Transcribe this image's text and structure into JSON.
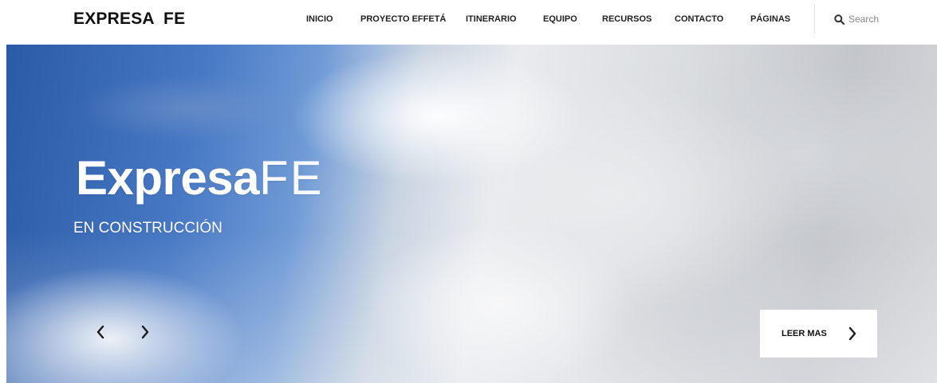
{
  "header": {
    "logo": "EXPRESA  FE",
    "nav": [
      {
        "label": "INICIO",
        "name": "nav-inicio"
      },
      {
        "label": "PROYECTO EFFETÁ",
        "name": "nav-proyecto-effeta"
      },
      {
        "label": "ITINERARIO",
        "name": "nav-itinerario"
      },
      {
        "label": "EQUIPO",
        "name": "nav-equipo"
      },
      {
        "label": "RECURSOS",
        "name": "nav-recursos"
      },
      {
        "label": "CONTACTO",
        "name": "nav-contacto"
      },
      {
        "label": "PÁGINAS",
        "name": "nav-paginas"
      }
    ],
    "search": {
      "placeholder": "Search",
      "value": "",
      "icon": "search-icon"
    }
  },
  "hero": {
    "title_strong": "Expresa",
    "title_light": "FE",
    "subtitle": "EN CONSTRUCCIÓN",
    "prev_icon": "chevron-left-icon",
    "next_icon": "chevron-right-icon",
    "read_more": {
      "label": "LEER MAS",
      "icon": "chevron-right-icon"
    }
  },
  "colors": {
    "text_dark": "#222222",
    "logo": "#111111",
    "sky_blue": "#2b5aa6",
    "cloud": "#e9ebee",
    "button_bg": "#ffffff"
  }
}
